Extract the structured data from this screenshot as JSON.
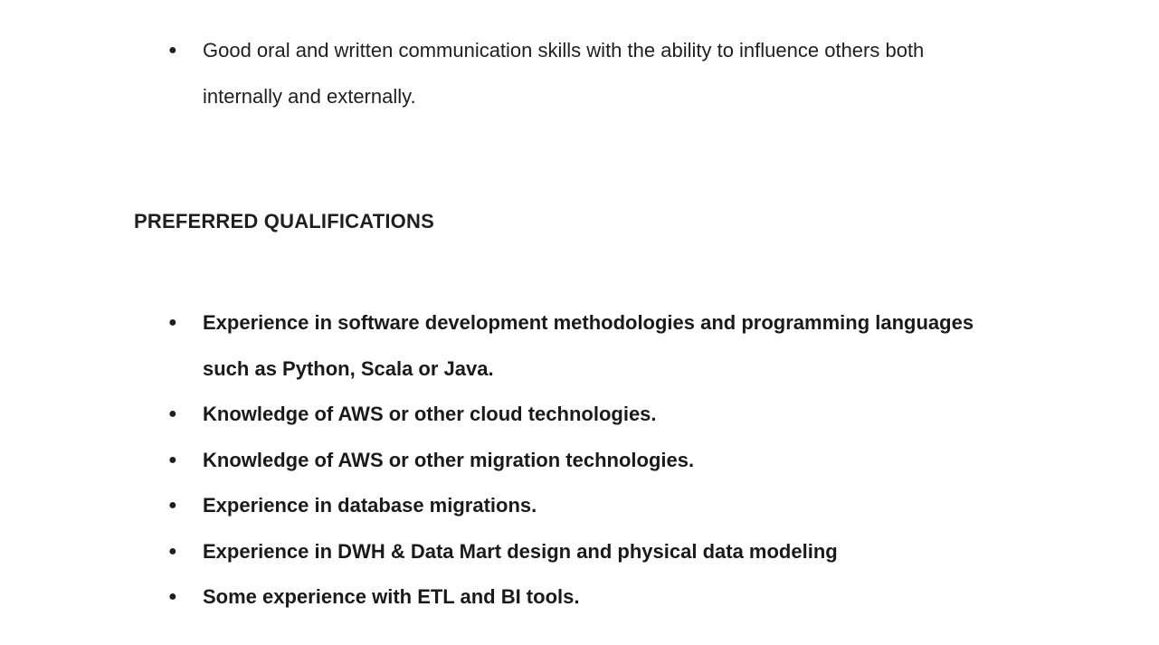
{
  "bullet_glyph": "●",
  "top_list": {
    "items": [
      "Good oral and written communication skills with the ability to influence others both internally and externally."
    ]
  },
  "preferred": {
    "heading": "PREFERRED QUALIFICATIONS",
    "items": [
      "Experience in software development methodologies and programming languages such as Python, Scala or Java.",
      "Knowledge of AWS or other cloud technologies.",
      "Knowledge of AWS or other migration technologies.",
      "Experience in database migrations.",
      "Experience in DWH & Data Mart design and physical data modeling",
      "Some experience with ETL and BI tools."
    ]
  }
}
